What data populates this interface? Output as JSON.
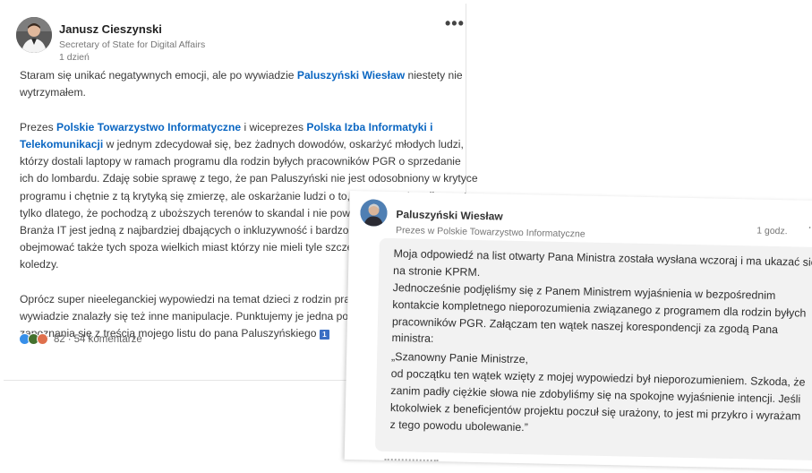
{
  "post": {
    "author": {
      "name": "Janusz Cieszynski",
      "title": "Secretary of State for Digital Affairs",
      "time": "1 dzień"
    },
    "more_label": "•••",
    "body": {
      "p1_l1_a": "Staram się unikać negatywnych emocji, ale po wywiadzie ",
      "p1_l1_mention": "Paluszyński Wiesław",
      "p1_l1_b": " niestety nie",
      "p1_l2": "wytrzymałem.",
      "p2_l1_a": "Prezes ",
      "p2_l1_m1": "Polskie Towarzystwo Informatyczne",
      "p2_l1_b": " i wiceprezes ",
      "p2_l1_m2": "Polska Izba Informatyki i",
      "p2_l2_m": "Telekomunikacji",
      "p2_l2_b": " w jednym zdecydował się, bez żadnych dowodów, oskarżyć młodych ludzi,",
      "p2_l3": "którzy dostali laptopy w ramach programu dla rodzin byłych pracowników PGR o sprzedanie",
      "p2_l4": "ich do lombardu. Zdaję sobie sprawę z tego, że pan Paluszyński nie jest odosobniony w krytyce",
      "p2_l5": "programu i chętnie z tą krytyką się zmierzę, ale oskarżanie ludzi o to, że zdefraudowali sprzęt",
      "p2_l6": "tylko dlatego, że pochodzą z uboższych terenów to skandal i nie powin",
      "p2_l7": "Branża IT jest jedną z najbardziej dbających o inkluzywność i bardzo do",
      "p2_l8": "obejmować także tych spoza wielkich miast którzy nie mieli tyle szczęś",
      "p2_l9": "koledzy.",
      "p3_l1": "Oprócz super nieeleganckiej wypowiedzi na temat dzieci z rodzin prac",
      "p3_l2": "wywiadzie znalazły się też inne manipulacje. Punktujemy je jedna po d",
      "p3_l3": "zapoznania się z treścią mojego listu do pana Paluszyńskiego",
      "badge": "1"
    },
    "reactions": {
      "count": "82",
      "separator": "·",
      "comments": "54 komentarze",
      "colors": [
        "#378fe9",
        "#44712e",
        "#df704d"
      ]
    }
  },
  "comment": {
    "author": {
      "name": "Paluszyński Wiesław",
      "title": "Prezes w Polskie Towarzystwo Informatyczne",
      "time": "1 godz."
    },
    "more_label": "·",
    "body": {
      "l1": "Moja odpowiedź na list otwarty Pana Ministra została wysłana wczoraj i ma ukazać się",
      "l2": "na stronie KPRM.",
      "l3": "Jednocześnie podjęliśmy się z Panem Ministrem wyjaśnienia w bezpośrednim",
      "l4": "kontakcie kompletnego nieporozumienia związanego z programem dla rodzin byłych",
      "l5": "pracowników PGR. Załączam ten wątek naszej korespondencji za zgodą Pana",
      "l6": "ministra:",
      "l7": "„Szanowny Panie Ministrze,",
      "l8": "od początku ten wątek wzięty z mojej wypowiedzi był nieporozumieniem. Szkoda, że",
      "l9": "zanim padły ciężkie słowa nie zdobyliśmy się na spokojne wyjaśnienie intencji. Jeśli",
      "l10": "ktokolwiek z beneficjentów projektu poczuł się urażony, to jest mi przykro i wyrażam",
      "l11": "z tego powodu ubolewanie.”"
    }
  },
  "colors": {
    "link": "#0a66c2",
    "text": "#3a3a3a",
    "muted": "#777777",
    "bubble": "#f2f2f2"
  }
}
